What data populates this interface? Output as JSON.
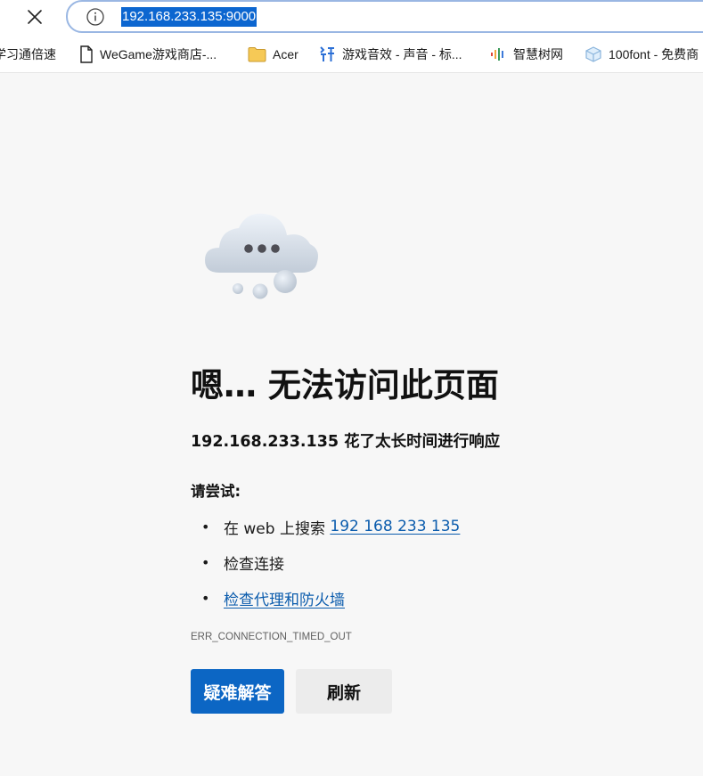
{
  "browser": {
    "close_icon": "close-icon",
    "info_icon": "info-icon",
    "url": "192.168.233.135:9000"
  },
  "bookmarks": [
    {
      "label": "学习通倍速",
      "icon": "none"
    },
    {
      "label": "WeGame游戏商店-...",
      "icon": "page-icon"
    },
    {
      "label": "Acer",
      "icon": "folder-icon"
    },
    {
      "label": "游戏音效 - 声音 - 标...",
      "icon": "sound-icon"
    },
    {
      "label": "智慧树网",
      "icon": "zhihuishu-icon"
    },
    {
      "label": "100font - 免费商",
      "icon": "cube-icon"
    }
  ],
  "error_page": {
    "heading": "嗯… 无法访问此页面",
    "subheading": "192.168.233.135 花了太长时间进行响应",
    "try_label": "请尝试:",
    "suggestions": {
      "search_prefix": "在 web 上搜索 ",
      "search_link": "192 168 233 135",
      "check_connection": "检查连接",
      "check_proxy": "检查代理和防火墙"
    },
    "bullet": "•",
    "error_code": "ERR_CONNECTION_TIMED_OUT",
    "buttons": {
      "troubleshoot": "疑难解答",
      "refresh": "刷新"
    }
  },
  "colors": {
    "primary_button": "#0c66c4",
    "link": "#0b5cad",
    "url_selection": "#0c66d0"
  }
}
